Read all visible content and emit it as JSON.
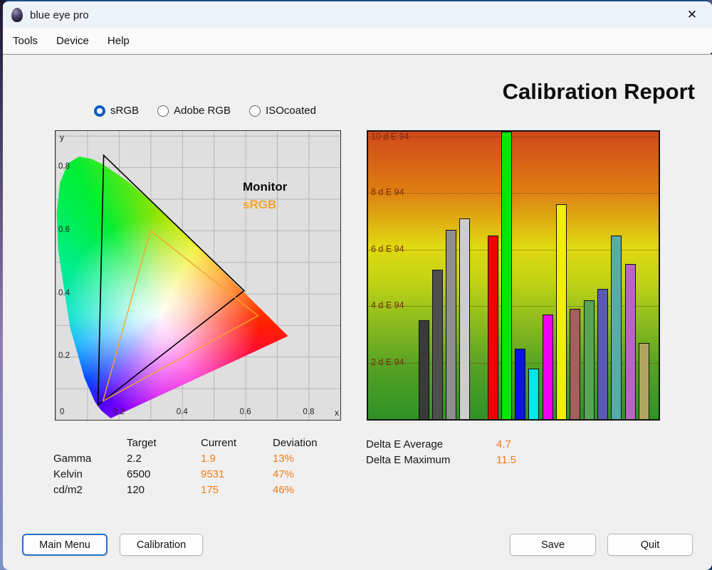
{
  "window": {
    "title": "blue eye pro",
    "close_glyph": "✕"
  },
  "menu": {
    "items": [
      "Tools",
      "Device",
      "Help"
    ]
  },
  "report": {
    "title": "Calibration Report"
  },
  "gamut_options": [
    {
      "label": "sRGB",
      "selected": true
    },
    {
      "label": "Adobe RGB",
      "selected": false
    },
    {
      "label": "ISOcoated",
      "selected": false
    }
  ],
  "chart_data": [
    {
      "type": "scatter",
      "title": "CIE 1931 xy chromaticity diagram with monitor and sRGB gamut triangles",
      "xlabel": "x",
      "ylabel": "y",
      "xlim": [
        0,
        0.9
      ],
      "ylim": [
        0,
        0.915
      ],
      "x_ticks": [
        0,
        0.2,
        0.4,
        0.6,
        0.8
      ],
      "y_ticks": [
        0.2,
        0.4,
        0.6,
        0.8
      ],
      "grid": true,
      "series": [
        {
          "name": "Monitor",
          "color": "#000000",
          "points": [
            [
              0.152,
              0.838
            ],
            [
              0.596,
              0.409
            ],
            [
              0.134,
              0.047
            ]
          ]
        },
        {
          "name": "sRGB",
          "color": "#f3a52c",
          "points": [
            [
              0.3,
              0.6
            ],
            [
              0.64,
              0.33
            ],
            [
              0.15,
              0.06
            ]
          ]
        }
      ]
    },
    {
      "type": "bar",
      "title": "Delta E 94 per color patch",
      "ylabel": "d E 94",
      "ylim": [
        0,
        10.17
      ],
      "y_ticks": [
        {
          "value": 2,
          "label": "2 d E 94"
        },
        {
          "value": 4,
          "label": "4 d E 94"
        },
        {
          "value": 6,
          "label": "6 d E 94"
        },
        {
          "value": 8,
          "label": "8 d E 94"
        },
        {
          "value": 10,
          "label": "10 d E 94"
        }
      ],
      "values": [
        3.5,
        5.3,
        6.7,
        7.1,
        6.5,
        11.5,
        2.5,
        1.8,
        3.7,
        7.6,
        3.9,
        4.2,
        4.6,
        6.5,
        5.5,
        2.7
      ],
      "bar_colors": [
        "#3a3a3a",
        "#4e4e4e",
        "#8e8e8e",
        "#cdcdcd",
        "#f00000",
        "#00e800",
        "#0b14e0",
        "#00e8e8",
        "#f000f0",
        "#f0f000",
        "#a65f5f",
        "#56a556",
        "#5a5ab4",
        "#58abab",
        "#b964c5",
        "#b2a65f"
      ]
    }
  ],
  "measurements": {
    "headers": [
      "Target",
      "Current",
      "Deviation"
    ],
    "rows": [
      {
        "label": "Gamma",
        "target": "2.2",
        "current": "1.9",
        "deviation": "13%"
      },
      {
        "label": "Kelvin",
        "target": "6500",
        "current": "9531",
        "deviation": "47%"
      },
      {
        "label": "cd/m2",
        "target": "120",
        "current": "175",
        "deviation": "46%"
      }
    ]
  },
  "delta_e": {
    "average_label": "Delta E Average",
    "average_value": "4.7",
    "maximum_label": "Delta E Maximum",
    "maximum_value": "11.5"
  },
  "buttons": {
    "main_menu": "Main Menu",
    "calibration": "Calibration",
    "save": "Save",
    "quit": "Quit"
  },
  "colors": {
    "accent_orange": "#ee7b18",
    "srgb_orange": "#f3a52c",
    "radio_blue": "#0a5dc2",
    "bar_tick_label": "#7b2a0d",
    "titlebar_accent": "#1e4c86"
  }
}
